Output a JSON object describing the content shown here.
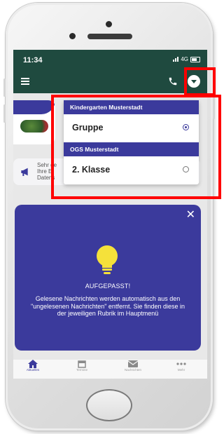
{
  "status_bar": {
    "time": "11:34",
    "network": "4G"
  },
  "header": {
    "menu_icon": "hamburger-icon",
    "call_icon": "phone-icon",
    "dropdown_icon": "chevron-down-circle-icon"
  },
  "group_selector": {
    "groups": [
      {
        "name": "Kindergarten Musterstadt",
        "option": "Gruppe",
        "selected": true
      },
      {
        "name": "OGS Musterstadt",
        "option": "2. Klasse",
        "selected": false
      }
    ]
  },
  "info_strip": {
    "lines": [
      "Sehr ge",
      "Ihre Ei",
      "Datens"
    ]
  },
  "notice": {
    "title": "AUFGEPASST!",
    "body": "Gelesene Nachrichten werden automatisch aus den \"ungelesenen Nachrichten\" entfernt. Sie finden diese in der jeweiligen Rubrik im Hauptmenü"
  },
  "tabs": [
    {
      "label": "Aktuelles",
      "icon": "home-icon",
      "active": true
    },
    {
      "label": "Termine",
      "icon": "calendar-icon",
      "active": false
    },
    {
      "label": "Nachrichten",
      "icon": "mail-icon",
      "active": false
    },
    {
      "label": "Mehr",
      "icon": "more-icon",
      "active": false
    }
  ],
  "colors": {
    "appbar": "#1f4a3f",
    "accent": "#3b3a9c",
    "highlight": "#ff0000"
  }
}
